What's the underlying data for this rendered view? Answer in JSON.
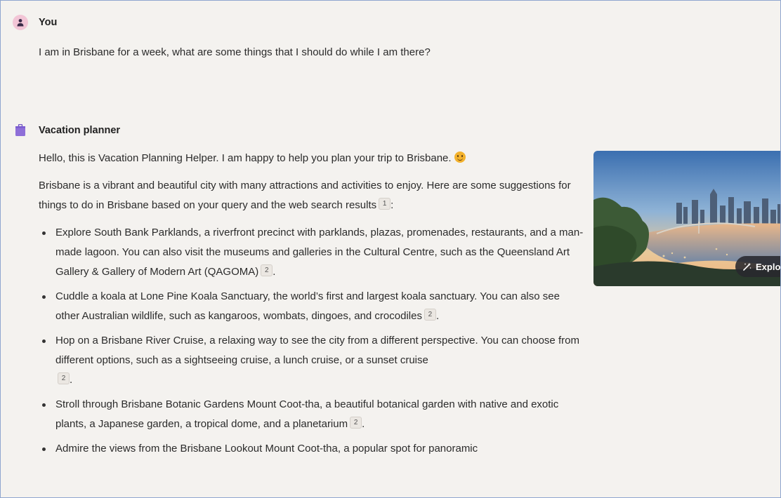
{
  "user_message": {
    "author": "You",
    "avatar_icon": "person-icon",
    "text": "I am in Brisbane for a week, what are some things that I should do while I am there?"
  },
  "bot_message": {
    "author": "Vacation planner",
    "avatar_icon": "suitcase-icon",
    "intro": "Hello, this is Vacation Planning Helper. I am happy to help you plan your trip to Brisbane.",
    "paragraph": "Brisbane is a vibrant and beautiful city with many attractions and activities to enjoy. Here are some suggestions for things to do in Brisbane based on your query and the web search results",
    "paragraph_cite": "1",
    "paragraph_end": ":",
    "bullets": [
      {
        "text": "Explore South Bank Parklands, a riverfront precinct with parklands, plazas, promenades, restaurants, and a man-made lagoon. You can also visit the museums and galleries in the Cultural Centre, such as the Queensland Art Gallery & Gallery of Modern Art (QAGOMA)",
        "cite": "2"
      },
      {
        "text": "Cuddle a koala at Lone Pine Koala Sanctuary, the world’s first and largest koala sanctuary. You can also see other Australian wildlife, such as kangaroos, wombats, dingoes, and crocodiles",
        "cite": "2"
      },
      {
        "text": "Hop on a Brisbane River Cruise, a relaxing way to see the city from a different perspective. You can choose from different options, such as a sightseeing cruise, a lunch cruise, or a sunset cruise",
        "cite": "2"
      },
      {
        "text": "Stroll through Brisbane Botanic Gardens Mount Coot-tha, a beautiful botanical garden with native and exotic plants, a Japanese garden, a tropical dome, and a planetarium",
        "cite": "2"
      },
      {
        "text": "Admire the views from the Brisbane Lookout Mount Coot-tha, a popular spot for panoramic",
        "cite": ""
      }
    ],
    "image": {
      "explore_label": "Explo",
      "explore_icon": "magic-wand-icon"
    }
  },
  "colors": {
    "background": "#f4f2ef",
    "frame_border": "#8fa6cf",
    "user_avatar": "#f2c5d6",
    "bot_avatar": "#8e6fd8",
    "citation_bg": "#ebe7e2"
  }
}
